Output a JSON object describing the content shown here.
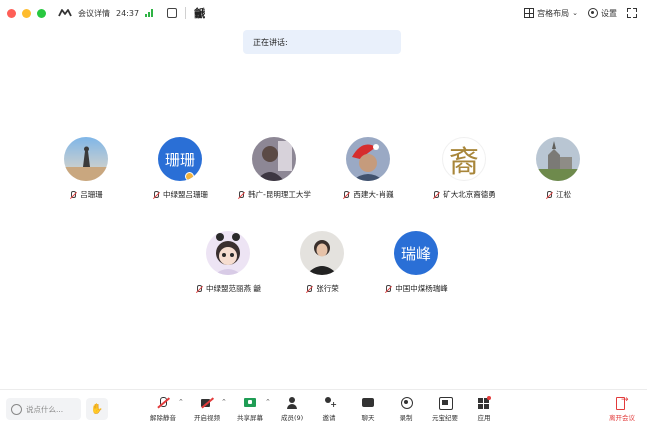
{
  "titlebar": {
    "meeting_details": "会议详情",
    "timer": "24:37",
    "user_glyph": "䶵",
    "grid_layout_label": "宫格布局",
    "settings_label": "设置"
  },
  "speaking": {
    "label": "正在讲话:"
  },
  "participants": [
    {
      "name": "吕珊珊",
      "avatar_text": ""
    },
    {
      "name": "中绿盟吕珊珊",
      "avatar_text": "珊珊"
    },
    {
      "name": "韩广-昆明理工大学",
      "avatar_text": ""
    },
    {
      "name": "西建大-肖巍",
      "avatar_text": ""
    },
    {
      "name": "矿大北京裔德勇",
      "avatar_text": "裔"
    },
    {
      "name": "江松",
      "avatar_text": ""
    },
    {
      "name": "中绿盟范丽燕 䶵",
      "avatar_text": ""
    },
    {
      "name": "张行荣",
      "avatar_text": ""
    },
    {
      "name": "中国中煤杨瑞峰",
      "avatar_text": "瑞峰"
    }
  ],
  "toolbar": {
    "chat_placeholder": "说点什么...",
    "unmute": "解除静音",
    "start_video": "开启视频",
    "share_screen": "共享屏幕",
    "members": "成员(9)",
    "invite": "邀请",
    "chat": "聊天",
    "record": "录制",
    "yuanbao": "元宝纪要",
    "apps": "应用",
    "leave": "离开会议"
  },
  "colors": {
    "accent_blue": "#2a6fd6",
    "leave_red": "#e23b3b",
    "speaking_bg": "#e9f0fb",
    "signal_green": "#2fb344"
  }
}
